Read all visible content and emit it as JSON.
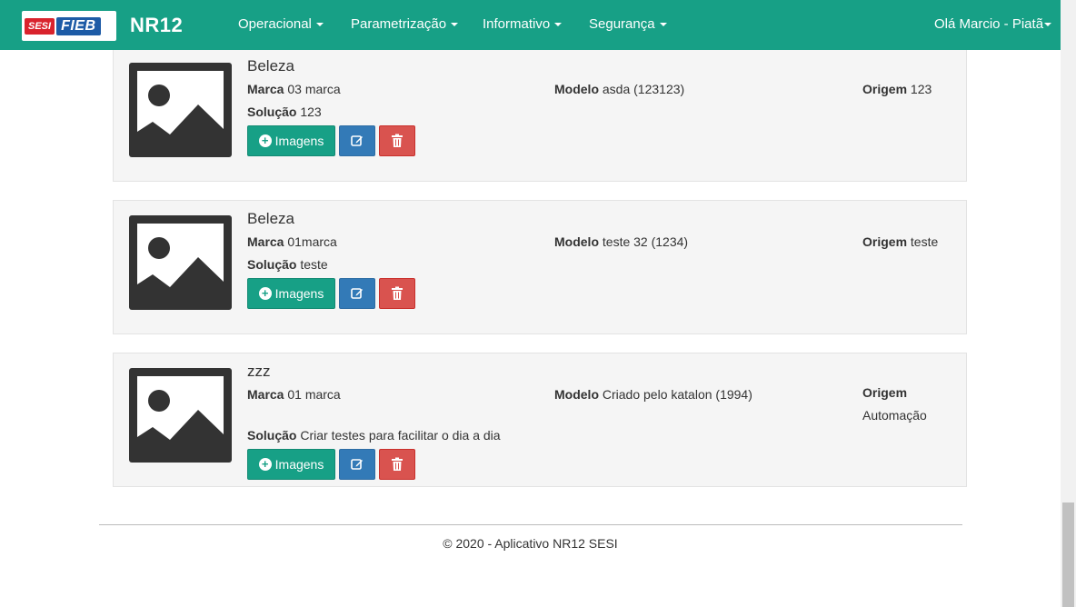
{
  "navbar": {
    "logo_left": "SESI",
    "logo_right": "FIEB",
    "brand": "NR12",
    "menus": [
      "Operacional",
      "Parametrização",
      "Informativo",
      "Segurança"
    ],
    "user": "Olá Marcio - Piatã"
  },
  "labels": {
    "marca": "Marca",
    "modelo": "Modelo",
    "origem": "Origem",
    "solucao": "Solução",
    "images_button": "Imagens"
  },
  "items": [
    {
      "title": "Beleza",
      "marca": "03 marca",
      "modelo": "asda (123123)",
      "origem": "123",
      "solucao": "123"
    },
    {
      "title": "Beleza",
      "marca": "01marca",
      "modelo": "teste 32 (1234)",
      "origem": "teste",
      "solucao": "teste"
    },
    {
      "title": "zzz",
      "marca": "01 marca",
      "modelo": "Criado pelo katalon (1994)",
      "origem": "Automação",
      "solucao": "Criar testes para facilitar o dia a dia"
    }
  ],
  "footer": {
    "text": "© 2020 - Aplicativo NR12 SESI"
  },
  "colors": {
    "primary": "#17a086",
    "edit": "#337ab7",
    "delete": "#d9534f"
  }
}
